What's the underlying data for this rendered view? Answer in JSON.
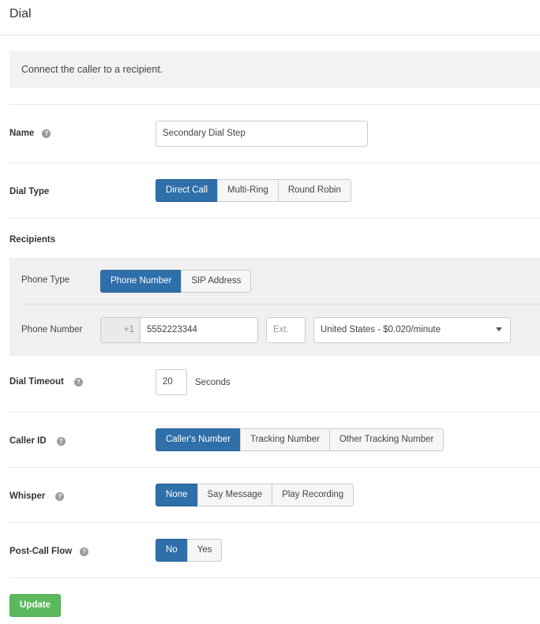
{
  "header": {
    "title": "Dial"
  },
  "description": "Connect the caller to a recipient.",
  "help_glyph": "?",
  "name": {
    "label": "Name",
    "value": "Secondary Dial Step"
  },
  "dial_type": {
    "label": "Dial Type",
    "options": [
      "Direct Call",
      "Multi-Ring",
      "Round Robin"
    ],
    "selected": "Direct Call"
  },
  "recipients": {
    "label": "Recipients",
    "phone_type": {
      "label": "Phone Type",
      "options": [
        "Phone Number",
        "SIP Address"
      ],
      "selected": "Phone Number"
    },
    "phone_number": {
      "label": "Phone Number",
      "country_code": "+1",
      "value": "5552223344",
      "ext_placeholder": "Ext.",
      "rate_selected": "United States - $0.020/minute"
    }
  },
  "dial_timeout": {
    "label": "Dial Timeout",
    "value": "20",
    "unit": "Seconds"
  },
  "caller_id": {
    "label": "Caller ID",
    "options": [
      "Caller's Number",
      "Tracking Number",
      "Other Tracking Number"
    ],
    "selected": "Caller's Number"
  },
  "whisper": {
    "label": "Whisper",
    "options": [
      "None",
      "Say Message",
      "Play Recording"
    ],
    "selected": "None"
  },
  "post_call_flow": {
    "label": "Post-Call Flow",
    "options": [
      "No",
      "Yes"
    ],
    "selected": "No"
  },
  "update_button": "Update",
  "colors": {
    "primary": "#2f6faa",
    "success": "#5cb85c"
  },
  "icons": {
    "help": "question-circle-icon",
    "dropdown": "caret-down-icon"
  }
}
